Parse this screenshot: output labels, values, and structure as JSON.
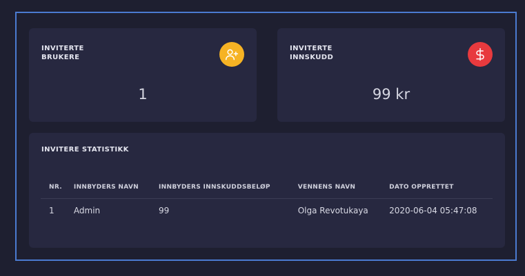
{
  "cards": {
    "invited_users": {
      "title_line1": "INVITERTE",
      "title_line2": "BRUKERE",
      "value": "1",
      "icon": "user-plus-icon",
      "icon_color": "#f6b324"
    },
    "invited_deposits": {
      "title_line1": "INVITERTE",
      "title_line2": "INNSKUDD",
      "value": "99 kr",
      "icon": "dollar-icon",
      "icon_color": "#e83a3e"
    }
  },
  "stats": {
    "title": "INVITERE STATISTIKK",
    "columns": [
      "NR.",
      "INNBYDERS NAVN",
      "INNBYDERS INNSKUDDSBELØP",
      "VENNENS NAVN",
      "DATO OPPRETTET"
    ],
    "rows": [
      [
        "1",
        "Admin",
        "99",
        "Olga Revotukaya",
        "2020-06-04 05:47:08"
      ]
    ]
  },
  "colors": {
    "background": "#1e1f30",
    "card": "#272840",
    "frame_border": "#4b7bd1"
  }
}
